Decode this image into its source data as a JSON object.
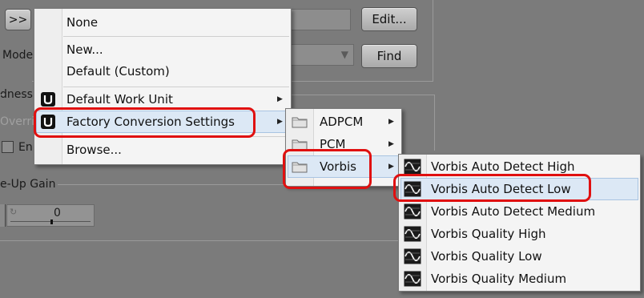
{
  "background": {
    "expand_button": ">>",
    "edit_button": "Edit...",
    "find_button": "Find",
    "mode_label": "Mode",
    "loudness_label": "dness",
    "override_label": "Overri",
    "enable_label": "En",
    "makeup_gain_label": "e-Up Gain",
    "gain_value": "0"
  },
  "main_menu": {
    "items": [
      {
        "label": "None"
      },
      {
        "label": "New..."
      },
      {
        "label": "Default (Custom)"
      },
      {
        "label": "Default Work Unit"
      },
      {
        "label": "Factory Conversion Settings"
      },
      {
        "label": "Browse..."
      }
    ]
  },
  "submenu_formats": {
    "items": [
      {
        "label": "ADPCM"
      },
      {
        "label": "PCM"
      },
      {
        "label": "Vorbis"
      }
    ]
  },
  "submenu_vorbis": {
    "items": [
      {
        "label": "Vorbis Auto Detect High"
      },
      {
        "label": "Vorbis Auto Detect Low"
      },
      {
        "label": "Vorbis Auto Detect Medium"
      },
      {
        "label": "Vorbis Quality High"
      },
      {
        "label": "Vorbis Quality Low"
      },
      {
        "label": "Vorbis Quality Medium"
      }
    ]
  },
  "colors": {
    "highlight_outline": "#e01010",
    "background": "#7b7b7b",
    "menu_bg": "#f4f4f4"
  }
}
